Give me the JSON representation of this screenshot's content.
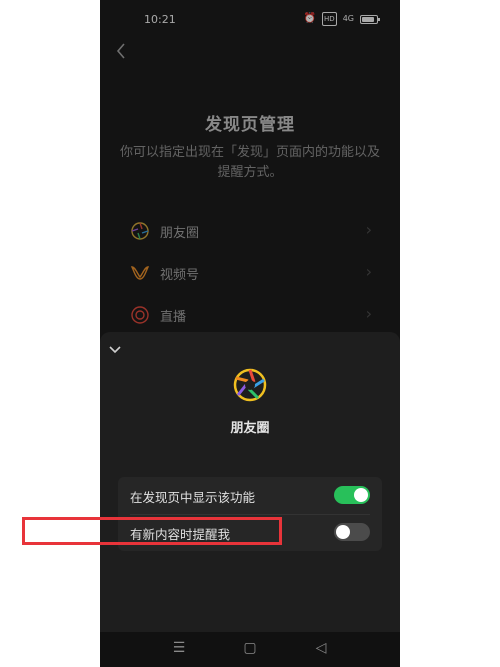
{
  "status_bar": {
    "time": "10:21",
    "alarm_icon": "alarm-icon",
    "hd_label": "HD",
    "signal_label": "4G",
    "battery_icon": "battery-icon"
  },
  "page": {
    "title": "发现页管理",
    "subtitle": "你可以指定出现在「发现」页面内的功能以及提醒方式。"
  },
  "list_items": [
    {
      "label": "朋友圈",
      "icon": "moments-icon"
    },
    {
      "label": "视频号",
      "icon": "channels-icon"
    },
    {
      "label": "直播",
      "icon": "live-icon"
    }
  ],
  "sheet": {
    "app_name": "朋友圈",
    "settings": [
      {
        "label": "在发现页中显示该功能",
        "enabled": true
      },
      {
        "label": "有新内容时提醒我",
        "enabled": false
      }
    ]
  },
  "colors": {
    "toggle_on": "#28c05a",
    "toggle_off": "#4b4b4b",
    "highlight": "#e8343a"
  }
}
